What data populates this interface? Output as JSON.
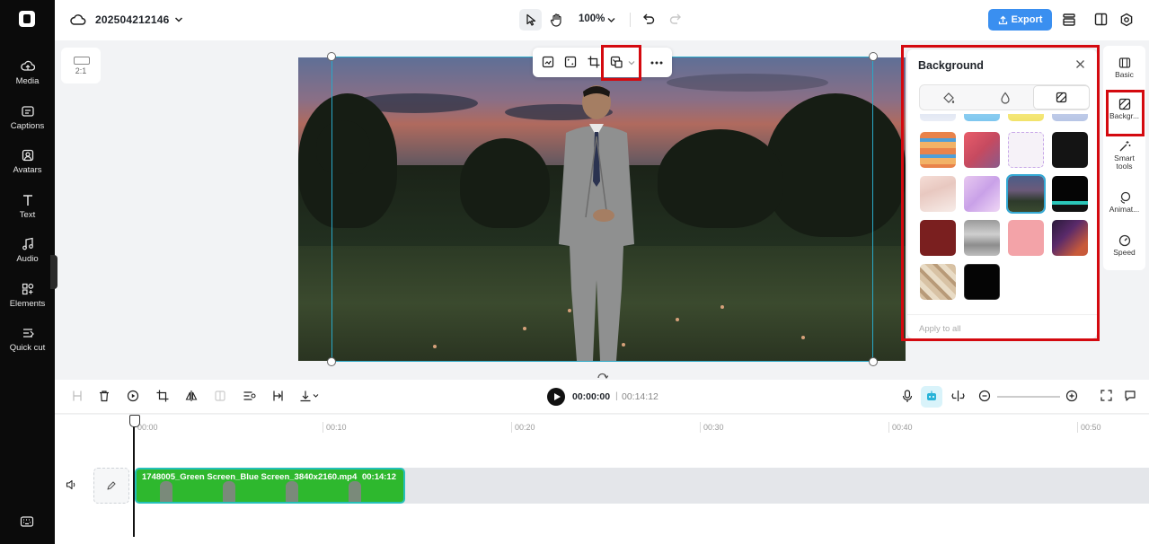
{
  "app": {
    "project_title": "202504212146",
    "zoom": "100%",
    "export_label": "Export",
    "aspect_ratio": "2:1"
  },
  "colors": {
    "accent": "#3a8ff0",
    "highlight": "#d4090f",
    "selection": "#29a8c7",
    "clip_green": "#2eb82e",
    "nav_bg": "#0b0b0b"
  },
  "leftnav": {
    "items": [
      {
        "label": "Media",
        "icon": "cloud-upload-icon"
      },
      {
        "label": "Captions",
        "icon": "captions-icon"
      },
      {
        "label": "Avatars",
        "icon": "avatar-icon"
      },
      {
        "label": "Text",
        "icon": "text-icon"
      },
      {
        "label": "Audio",
        "icon": "music-note-icon"
      },
      {
        "label": "Elements",
        "icon": "elements-icon"
      },
      {
        "label": "Quick cut",
        "icon": "quick-cut-icon"
      }
    ]
  },
  "background_panel": {
    "title": "Background",
    "tabs": [
      "color-fill-icon",
      "blur-icon",
      "image-pattern-icon"
    ],
    "active_tab": 2,
    "selected_tile": 6,
    "apply_all": "Apply to all"
  },
  "right_rail": {
    "items": [
      {
        "label": "Basic",
        "icon": "basic-icon"
      },
      {
        "label": "Backgr...",
        "icon": "background-icon"
      },
      {
        "label": "Smart tools",
        "icon": "magic-wand-icon"
      },
      {
        "label": "Animat...",
        "icon": "animation-icon"
      },
      {
        "label": "Speed",
        "icon": "speed-icon"
      }
    ]
  },
  "playback": {
    "current": "00:00:00",
    "separator": "|",
    "total": "00:14:12"
  },
  "timeline": {
    "ticks": [
      "00:00",
      "00:10",
      "00:20",
      "00:30",
      "00:40",
      "00:50"
    ],
    "clip": {
      "name": "1748005_Green Screen_Blue Screen_3840x2160.mp4",
      "duration": "00:14:12"
    }
  }
}
